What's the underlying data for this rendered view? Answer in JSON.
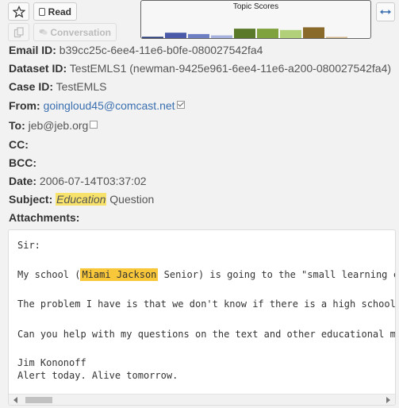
{
  "toolbar": {
    "read_label": "Read",
    "conversation_label": "Conversation",
    "star_icon": "star-icon",
    "copy_icon": "copy-icon",
    "chat_icon": "chat-icon",
    "expand_icon": "expand-arrows-icon"
  },
  "topic_scores": {
    "title": "Topic Scores",
    "colors": [
      "#2b3f7a",
      "#4a5aa8",
      "#6f7fc4",
      "#a6b1dd",
      "#5a7a2a",
      "#7fa13e",
      "#b2d07a",
      "#8a6a2a",
      "#d0b48a"
    ],
    "levels": [
      0.05,
      0.2,
      0.15,
      0.1,
      0.35,
      0.35,
      0.3,
      0.4,
      0.03
    ]
  },
  "email": {
    "email_id_key": "Email ID:",
    "email_id": "b39cc25c-6ee4-11e6-b0fe-080027542fa4",
    "dataset_id_key": "Dataset ID:",
    "dataset_id": "TestEMLS1 (newman-9425e961-6ee4-11e6-a200-080027542fa4)",
    "case_id_key": "Case ID:",
    "case_id": "TestEMLS",
    "from_key": "From:",
    "from": "goingloud45@comcast.net",
    "to_key": "To:",
    "to": "jeb@jeb.org",
    "cc_key": "CC:",
    "bcc_key": "BCC:",
    "date_key": "Date:",
    "date": "2006-07-14T03:37:02",
    "subject_key": "Subject:",
    "subject_highlight": "Education",
    "subject_rest": "Question",
    "attachments_key": "Attachments:"
  },
  "body": {
    "line1": "Sir:",
    "line2_pre": "My school (",
    "line2_highlight": "Miami Jackson",
    "line2_post": " Senior) is going to the \"small learning co",
    "line3": "The problem I have is that we don't know if there is a high school",
    "line4": "Can you help with my questions on the text and other educational ma",
    "line5": "Jim Kononoff",
    "line6": "Alert today. Alive tomorrow."
  }
}
